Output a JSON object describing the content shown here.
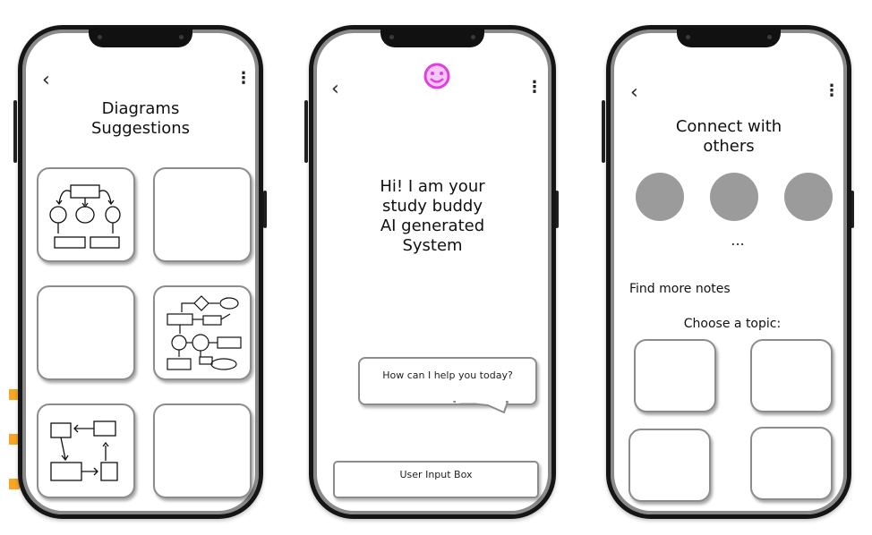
{
  "phone1": {
    "back_icon": "chevron-left-icon",
    "menu_icon": "more-vertical-icon",
    "title_line1": "Diagrams",
    "title_line2": "Suggestions"
  },
  "phone2": {
    "back_icon": "chevron-left-icon",
    "menu_icon": "more-vertical-icon",
    "status_icon": "smiley-face-icon",
    "headline_lines": [
      "Hi! I am your",
      "study buddy",
      "AI generated",
      "System"
    ],
    "chat_bubble": "How can I help you today?",
    "input_box": "User Input Box"
  },
  "phone3": {
    "back_icon": "chevron-left-icon",
    "menu_icon": "more-vertical-icon",
    "title_line1": "Connect with",
    "title_line2": "others",
    "ellipsis": "...",
    "find_more": "Find more notes",
    "choose_topic": "Choose a topic:"
  },
  "colors": {
    "frame": "#151515",
    "tile_border": "#8c8c8c",
    "avatar": "#9b9b9b",
    "accent": "#f6a623",
    "smiley": "#e040e0"
  }
}
